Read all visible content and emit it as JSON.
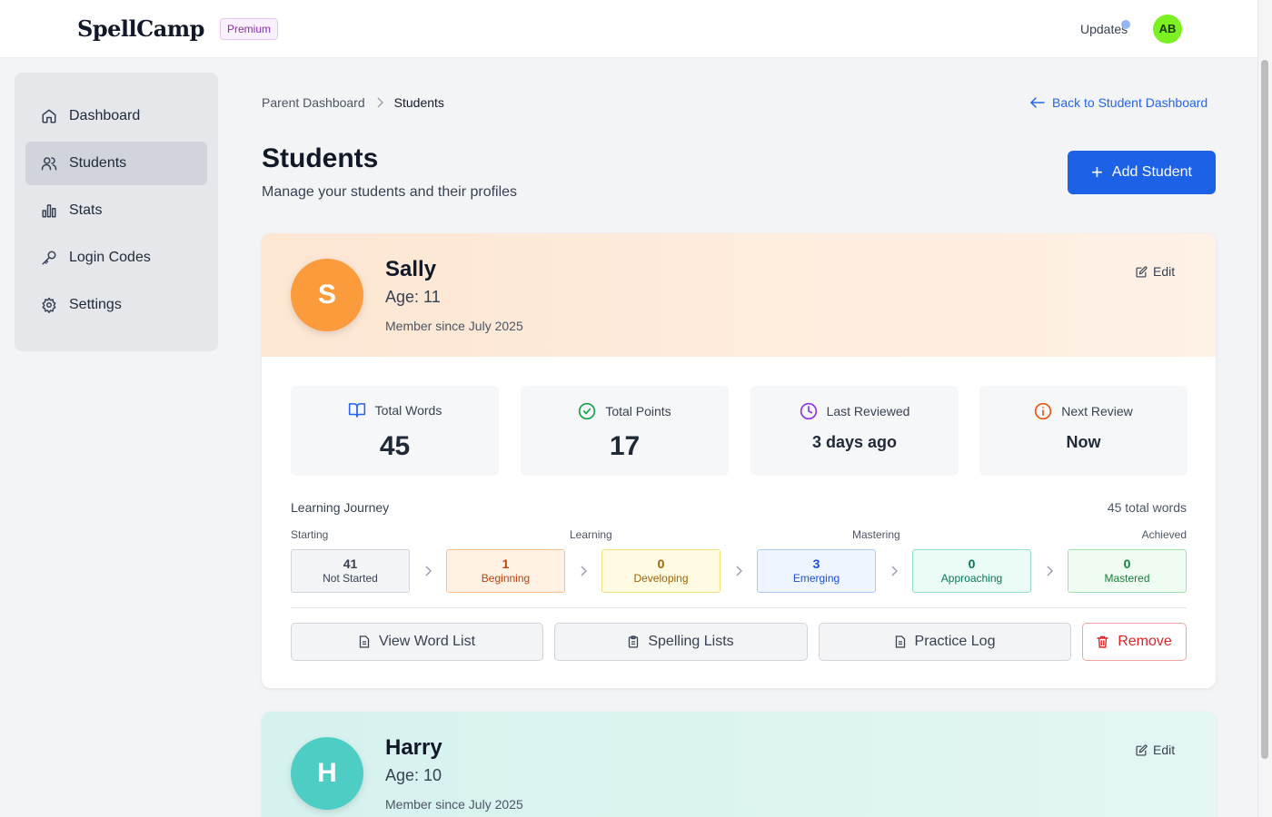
{
  "header": {
    "logo": "SpellCamp",
    "badge": "Premium",
    "updates": "Updates",
    "avatar_initials": "AB"
  },
  "sidebar": {
    "items": [
      {
        "label": "Dashboard",
        "icon": "home-icon"
      },
      {
        "label": "Students",
        "icon": "users-icon",
        "active": true
      },
      {
        "label": "Stats",
        "icon": "bar-chart-icon"
      },
      {
        "label": "Login Codes",
        "icon": "key-icon"
      },
      {
        "label": "Settings",
        "icon": "gear-icon"
      }
    ]
  },
  "breadcrumb": {
    "parent": "Parent Dashboard",
    "current": "Students"
  },
  "back_link": "Back to Student Dashboard",
  "page": {
    "title": "Students",
    "subtitle": "Manage your students and their profiles",
    "add_button": "Add Student"
  },
  "students": [
    {
      "initial": "S",
      "name": "Sally",
      "age": "Age: 11",
      "since": "Member since July 2025",
      "edit": "Edit",
      "color": "#fb9b3c",
      "stats": [
        {
          "label": "Total Words",
          "value": "45"
        },
        {
          "label": "Total Points",
          "value": "17"
        },
        {
          "label": "Last Reviewed",
          "value": "3 days ago"
        },
        {
          "label": "Next Review",
          "value": "Now"
        }
      ],
      "journey": {
        "title": "Learning Journey",
        "total": "45 total words",
        "phases": [
          "Starting",
          "Learning",
          "Mastering",
          "Achieved"
        ],
        "stages": [
          {
            "count": "41",
            "label": "Not Started"
          },
          {
            "count": "1",
            "label": "Beginning"
          },
          {
            "count": "0",
            "label": "Developing"
          },
          {
            "count": "3",
            "label": "Emerging"
          },
          {
            "count": "0",
            "label": "Approaching"
          },
          {
            "count": "0",
            "label": "Mastered"
          }
        ]
      },
      "actions": [
        "View Word List",
        "Spelling Lists",
        "Practice Log",
        "Remove"
      ]
    },
    {
      "initial": "H",
      "name": "Harry",
      "age": "Age: 10",
      "since": "Member since July 2025",
      "edit": "Edit",
      "color": "#4ecdc4"
    }
  ],
  "colors": {
    "accent": "#1d62e6",
    "premium": "#8b2fb3",
    "remove": "#dc2626"
  }
}
